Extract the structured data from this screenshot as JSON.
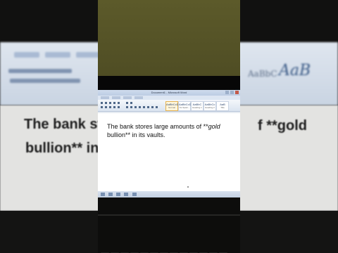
{
  "window": {
    "title": "Document1 - Microsoft Word"
  },
  "document": {
    "prefix": "The bank stores large amounts of **",
    "emphasis": "gold",
    "suffix": " bullion** in its vaults."
  },
  "background_zoom": {
    "line1": "The bank st",
    "line1_right": "f **gold",
    "line2": "bullion** in",
    "style_preview": "AaB",
    "style_preview_small": "AaBbC"
  },
  "ribbon": {
    "styles": [
      {
        "preview": "AaBbCcDc",
        "name": "Normal"
      },
      {
        "preview": "AaBbCcDc",
        "name": "No Spaci..."
      },
      {
        "preview": "AaBbC",
        "name": "Heading 1"
      },
      {
        "preview": "AaBbCc",
        "name": "Heading 2"
      },
      {
        "preview": "AaB",
        "name": "Title"
      }
    ]
  },
  "colors": {
    "wall": "#5c5a2a",
    "ribbon": "#dbe4f0",
    "page": "#ffffff",
    "bezel": "#070707"
  }
}
